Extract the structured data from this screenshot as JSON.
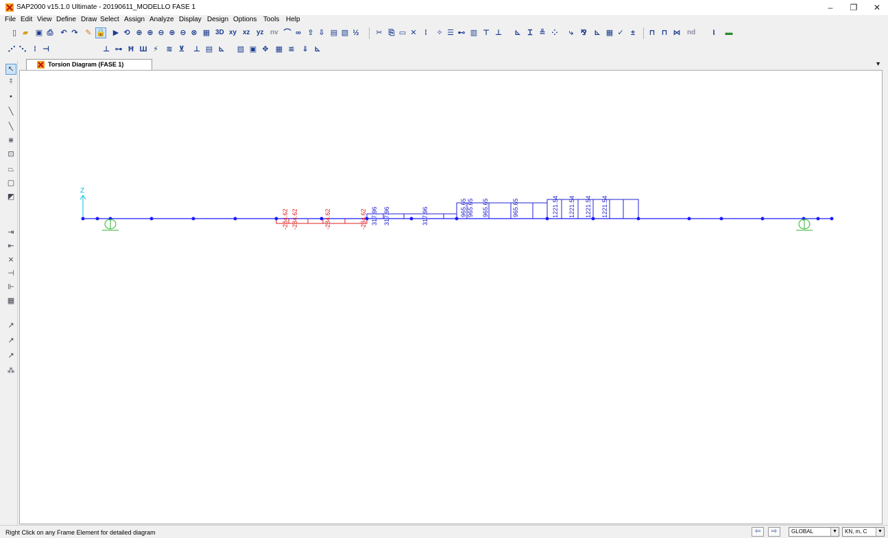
{
  "window": {
    "title": "SAP2000 v15.1.0 Ultimate  - 20190611_MODELLO FASE 1",
    "minimize": "–",
    "restore": "❐",
    "close": "✕"
  },
  "menu": [
    "File",
    "Edit",
    "View",
    "Define",
    "Draw",
    "Select",
    "Assign",
    "Analyze",
    "Display",
    "Design",
    "Options",
    "Tools",
    "Help"
  ],
  "toolbar": {
    "icons": [
      "new-icon",
      "open-icon",
      "save-icon",
      "print-icon",
      "undo-icon",
      "redo-icon",
      "pencil-icon",
      "lock-icon",
      "run-icon",
      "rubber-band-zoom-icon",
      "zoom-in-icon",
      "zoom-out-icon",
      "pan-icon",
      "restore-view-icon",
      "refresh-icon",
      "3d-view-icon",
      "xy-view-icon",
      "xz-view-icon",
      "yz-view-icon",
      "nv-view-icon",
      "perspective-icon",
      "rotate-icon",
      "up-icon",
      "down-icon"
    ],
    "text_buttons": [
      "3D",
      "xy",
      "xz",
      "yz",
      "nv"
    ]
  },
  "tab": {
    "label": "Torsion Diagram  (FASE 1)"
  },
  "diagram": {
    "axis_label": "Z",
    "negative_values": [
      "-284.62",
      "-284.62",
      "-284.62",
      "-284.62"
    ],
    "positive_values_1": [
      "317.96",
      "317.96",
      "317.96"
    ],
    "positive_values_2": [
      "965.65",
      "965.65",
      "965.65",
      "965.65"
    ],
    "positive_values_3": [
      "1221.54",
      "1221.54",
      "1221.54",
      "1221.54"
    ],
    "colors": {
      "positive": "#2020d0",
      "negative": "#e02020",
      "frame": "#1a1aff",
      "support": "#2bb52b",
      "axis": "#00c0e0"
    }
  },
  "status": {
    "text": "Right Click on any Frame Element for detailed diagram",
    "coord_system": "GLOBAL",
    "units": "KN, m, C"
  }
}
